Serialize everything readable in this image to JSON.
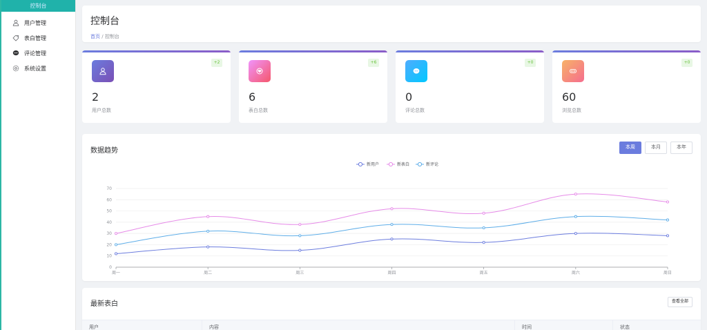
{
  "sidebar": {
    "top_label": "控制台",
    "items": [
      {
        "label": "用户管理",
        "icon": "user-icon"
      },
      {
        "label": "表白管理",
        "icon": "heart-tag-icon"
      },
      {
        "label": "评论管理",
        "icon": "comment-icon"
      },
      {
        "label": "系统设置",
        "icon": "gear-icon"
      }
    ]
  },
  "header": {
    "title": "控制台",
    "breadcrumb_home": "首页",
    "breadcrumb_sep": "/",
    "breadcrumb_current": "控制台"
  },
  "stats": [
    {
      "value": "2",
      "label": "用户总数",
      "badge": "+2",
      "icon": "user-icon",
      "color_from": "#6b7cde",
      "color_to": "#7a4fb5"
    },
    {
      "value": "6",
      "label": "表白总数",
      "badge": "+6",
      "icon": "heart-icon",
      "color_from": "#f093fb",
      "color_to": "#f5576c"
    },
    {
      "value": "0",
      "label": "评论总数",
      "badge": "+0",
      "icon": "comment-icon",
      "color_from": "#4facfe",
      "color_to": "#00c8ff"
    },
    {
      "value": "60",
      "label": "浏览总数",
      "badge": "+0",
      "icon": "eye-icon",
      "color_from": "#f7b267",
      "color_to": "#f56d8e"
    }
  ],
  "chart_section": {
    "title": "数据趋势",
    "tabs": [
      {
        "label": "本周",
        "active": true
      },
      {
        "label": "本月",
        "active": false
      },
      {
        "label": "本年",
        "active": false
      }
    ]
  },
  "chart_data": {
    "type": "line",
    "categories": [
      "周一",
      "周二",
      "周三",
      "周四",
      "周五",
      "周六",
      "周日"
    ],
    "series": [
      {
        "name": "新用户",
        "values": [
          12,
          18,
          15,
          25,
          22,
          30,
          28
        ],
        "color": "#6b7cde"
      },
      {
        "name": "新表白",
        "values": [
          30,
          45,
          38,
          52,
          48,
          65,
          58
        ],
        "color": "#e68ae8"
      },
      {
        "name": "新评论",
        "values": [
          20,
          32,
          28,
          38,
          35,
          45,
          42
        ],
        "color": "#5dade8"
      }
    ],
    "yticks": [
      0,
      10,
      20,
      30,
      40,
      50,
      60,
      70
    ],
    "ylim": [
      0,
      70
    ],
    "legend": "top-center",
    "grid": true
  },
  "recent": {
    "title": "最新表白",
    "view_all": "查看全部",
    "columns": [
      "用户",
      "内容",
      "时间",
      "状态"
    ]
  }
}
